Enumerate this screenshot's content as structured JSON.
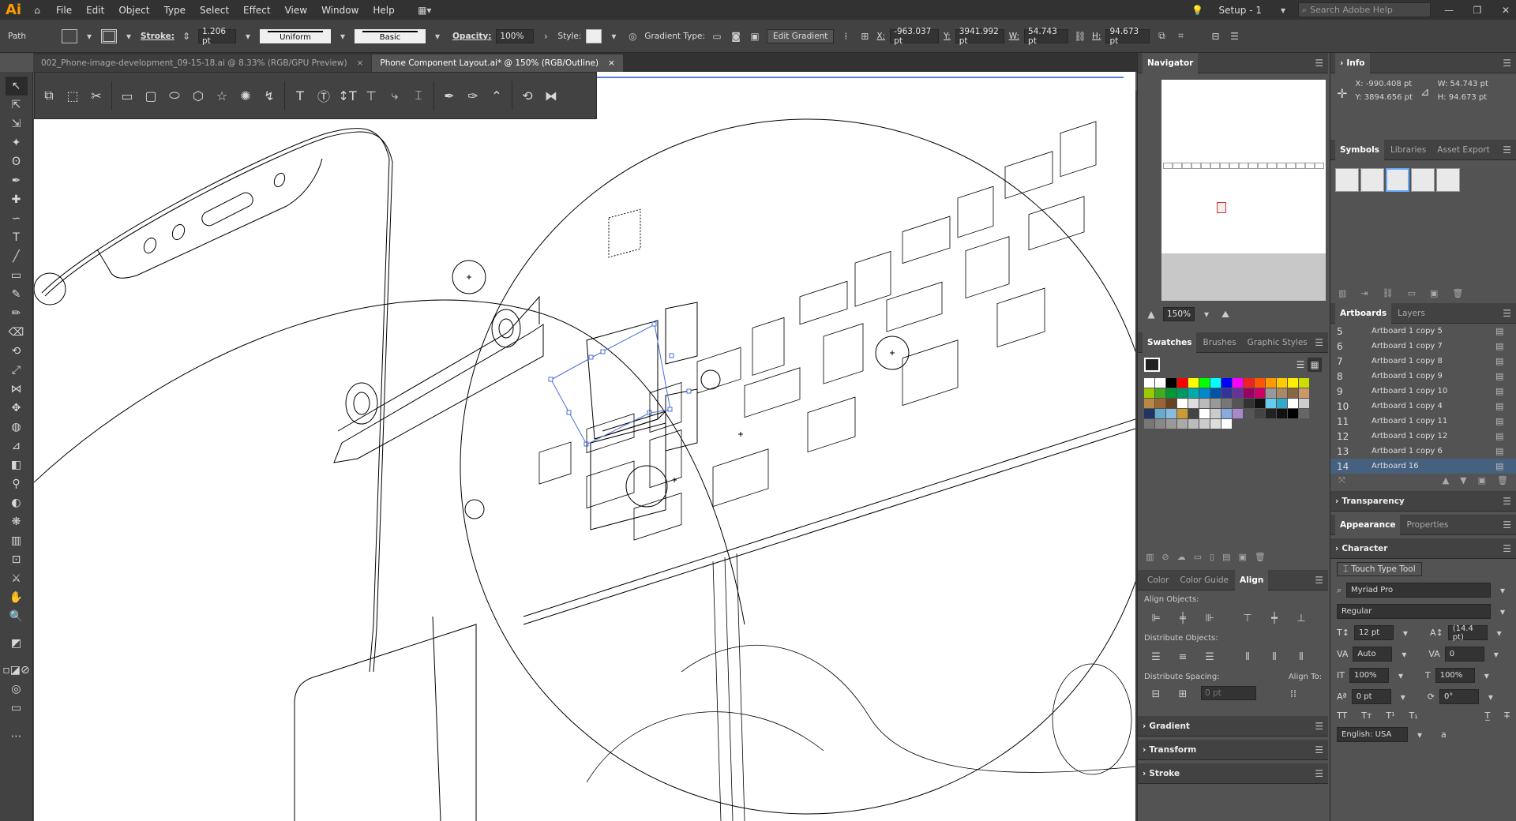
{
  "app": {
    "logo": "Ai"
  },
  "menu": [
    "File",
    "Edit",
    "Object",
    "Type",
    "Select",
    "Effect",
    "View",
    "Window",
    "Help"
  ],
  "workspace": "Setup - 1",
  "search_placeholder": "Search Adobe Help",
  "control": {
    "object_type": "Path",
    "stroke_label": "Stroke:",
    "stroke_value": "1.206 pt",
    "profile_uniform": "Uniform",
    "brush_basic": "Basic",
    "opacity_label": "Opacity:",
    "opacity_value": "100%",
    "style_label": "Style:",
    "gradient_type_label": "Gradient Type:",
    "edit_gradient": "Edit Gradient",
    "x_label": "X:",
    "x_value": "-963.037 pt",
    "y_label": "Y:",
    "y_value": "3941.992 pt",
    "w_label": "W:",
    "w_value": "54.743 pt",
    "h_label": "H:",
    "h_value": "94.673 pt"
  },
  "tabs": [
    {
      "label": "002_Phone-image-development_09-15-18.ai @ 8.33% (RGB/GPU Preview)",
      "close": "×"
    },
    {
      "label": "Phone Component Layout.ai* @ 150% (RGB/Outline)",
      "close": "×"
    }
  ],
  "navigator": {
    "title": "Navigator",
    "zoom": "150%"
  },
  "swatches": {
    "tabs": [
      "Swatches",
      "Brushes",
      "Graphic Styles"
    ]
  },
  "align": {
    "tabs": [
      "Color",
      "Color Guide",
      "Align"
    ],
    "align_objects": "Align Objects:",
    "distribute_objects": "Distribute Objects:",
    "distribute_spacing": "Distribute Spacing:",
    "align_to": "Align To:",
    "spacing_value": "0 pt"
  },
  "collapsed_left": [
    "Gradient",
    "Transform",
    "Stroke"
  ],
  "info": {
    "title": "Info",
    "x": "X: -990.408 pt",
    "y": "Y: 3894.656 pt",
    "w": "W: 54.743 pt",
    "h": "H: 94.673 pt"
  },
  "symbols": {
    "tabs": [
      "Symbols",
      "Libraries",
      "Asset Export"
    ]
  },
  "artboards": {
    "tabs": [
      "Artboards",
      "Layers"
    ],
    "rows": [
      {
        "num": "5",
        "name": "Artboard 1 copy 5"
      },
      {
        "num": "6",
        "name": "Artboard 1 copy 7"
      },
      {
        "num": "7",
        "name": "Artboard 1 copy 8"
      },
      {
        "num": "8",
        "name": "Artboard 1 copy 9"
      },
      {
        "num": "9",
        "name": "Artboard 1 copy 10"
      },
      {
        "num": "10",
        "name": "Artboard 1 copy 4"
      },
      {
        "num": "11",
        "name": "Artboard 1 copy 11"
      },
      {
        "num": "12",
        "name": "Artboard 1 copy 12"
      },
      {
        "num": "13",
        "name": "Artboard 1 copy 6"
      },
      {
        "num": "14",
        "name": "Artboard 16"
      }
    ]
  },
  "transparency": "Transparency",
  "appearance": {
    "tabs": [
      "Appearance",
      "Properties"
    ]
  },
  "character": {
    "title": "Character",
    "touch_type": "Touch Type Tool",
    "font": "Myriad Pro",
    "style": "Regular",
    "size": "12 pt",
    "leading": "(14.4 pt)",
    "kerning": "Auto",
    "tracking": "0",
    "vscale": "100%",
    "hscale": "100%",
    "baseline": "0 pt",
    "rotation": "0°",
    "language": "English: USA",
    "aa": "a"
  },
  "colors": {
    "accent": "#46607f",
    "logo": "#ff9a00",
    "selection": "#4a6fd8"
  }
}
